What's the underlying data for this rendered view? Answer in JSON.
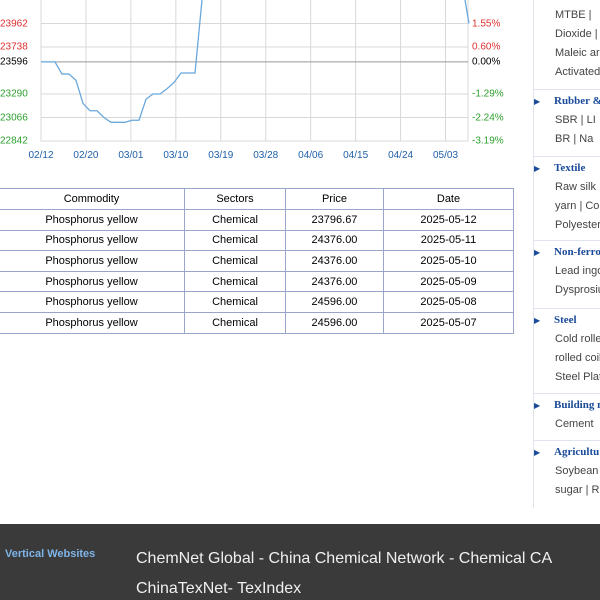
{
  "chart_data": {
    "type": "line",
    "y_left_ticks": [
      "23962",
      "23738",
      "23596",
      "23290",
      "23066",
      "22842"
    ],
    "y_right_ticks": [
      "1.55%",
      "0.60%",
      "0.00%",
      "-1.29%",
      "-2.24%",
      "-3.19%"
    ],
    "x_ticks": [
      "02/12",
      "02/20",
      "03/01",
      "03/10",
      "03/19",
      "03/28",
      "04/06",
      "04/15",
      "04/24",
      "05/03"
    ],
    "baseline_value": 23596,
    "ylim": [
      22842,
      24186
    ],
    "series": [
      {
        "values": [
          23596,
          23596,
          23596,
          23480,
          23480,
          23420,
          23200,
          23130,
          23130,
          23066,
          23020,
          23020,
          23020,
          23040,
          23040,
          23240,
          23290,
          23290,
          23340,
          23400,
          23490,
          23490,
          23490,
          24186
        ]
      },
      {
        "values": [
          24186,
          23962
        ]
      }
    ],
    "colors": {
      "line": "#6aa8dc",
      "grid": "#d8d8d8",
      "baseline": "#999999",
      "positive": "#e03030",
      "zero": "#000000",
      "negative": "#2ea02e"
    }
  },
  "table": {
    "headers": [
      "Commodity",
      "Sectors",
      "Price",
      "Date"
    ],
    "rows": [
      [
        "Phosphorus yellow",
        "Chemical",
        "23796.67",
        "2025-05-12"
      ],
      [
        "Phosphorus yellow",
        "Chemical",
        "24376.00",
        "2025-05-11"
      ],
      [
        "Phosphorus yellow",
        "Chemical",
        "24376.00",
        "2025-05-10"
      ],
      [
        "Phosphorus yellow",
        "Chemical",
        "24376.00",
        "2025-05-09"
      ],
      [
        "Phosphorus yellow",
        "Chemical",
        "24596.00",
        "2025-05-08"
      ],
      [
        "Phosphorus yellow",
        "Chemical",
        "24596.00",
        "2025-05-07"
      ]
    ]
  },
  "sidebar": {
    "chemical_lines": [
      "MTBE |",
      "Dioxide |",
      "Maleic ar",
      "Activated"
    ],
    "groups": [
      {
        "head": "Rubber &",
        "icon": "triangle-right-icon",
        "lines": [
          "SBR | LI",
          "BR | Na"
        ]
      },
      {
        "head": "Textile",
        "icon": "triangle-right-icon",
        "lines": [
          "Raw silk",
          "yarn | Co",
          "Polyester"
        ]
      },
      {
        "head": "Non-ferro",
        "icon": "triangle-right-icon",
        "lines": [
          "Lead ingo",
          "Dysprosiu"
        ]
      },
      {
        "head": "Steel",
        "icon": "triangle-right-icon",
        "lines": [
          "Cold rolle",
          "rolled coil",
          "Steel Plat"
        ]
      },
      {
        "head": "Building m",
        "icon": "triangle-right-icon",
        "lines": [
          "Cement"
        ]
      },
      {
        "head": "Agricultu",
        "icon": "triangle-right-icon",
        "lines": [
          "Soybean",
          "sugar | R"
        ]
      }
    ]
  },
  "footer": {
    "label": "Vertical Websites",
    "line1": "ChemNet Global - China Chemical Network - Chemical CA",
    "line2": "ChinaTexNet- TexIndex"
  }
}
